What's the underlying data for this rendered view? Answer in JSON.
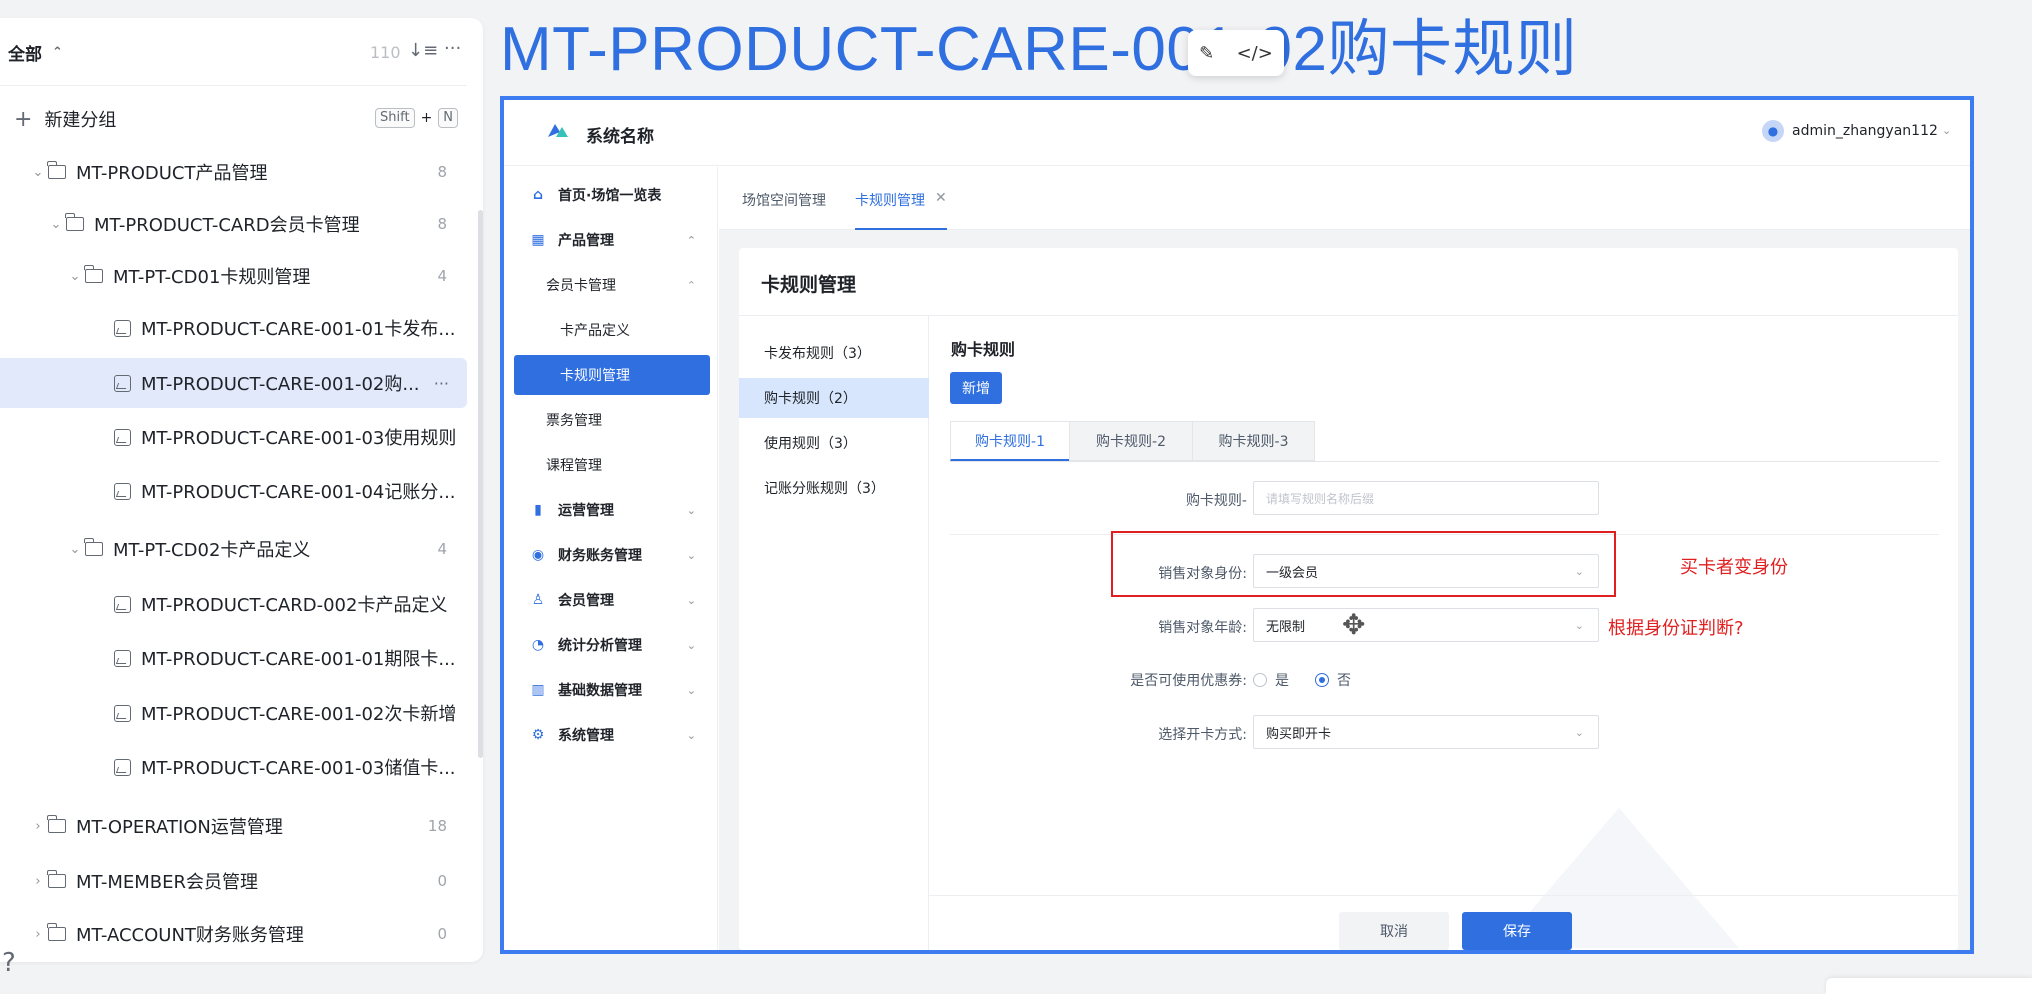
{
  "left_panel": {
    "header_title": "全部",
    "header_count": "110",
    "new_group_label": "新建分组",
    "shortcut": {
      "key1": "Shift",
      "plus": "+",
      "key2": "N"
    },
    "tree": [
      {
        "label": "MT-PRODUCT产品管理",
        "count": "8"
      },
      {
        "label": "MT-PRODUCT-CARD会员卡管理",
        "count": "8"
      },
      {
        "label": "MT-PT-CD01卡规则管理",
        "count": "4"
      },
      {
        "label": "MT-PRODUCT-CARE-001-01卡发布..."
      },
      {
        "label": "MT-PRODUCT-CARE-001-02购..."
      },
      {
        "label": "MT-PRODUCT-CARE-001-03使用规则"
      },
      {
        "label": "MT-PRODUCT-CARE-001-04记账分..."
      },
      {
        "label": "MT-PT-CD02卡产品定义",
        "count": "4"
      },
      {
        "label": "MT-PRODUCT-CARD-002卡产品定义"
      },
      {
        "label": "MT-PRODUCT-CARE-001-01期限卡..."
      },
      {
        "label": "MT-PRODUCT-CARE-001-02次卡新增"
      },
      {
        "label": "MT-PRODUCT-CARE-001-03储值卡..."
      },
      {
        "label": "MT-OPERATION运营管理",
        "count": "18"
      },
      {
        "label": "MT-MEMBER会员管理",
        "count": "0"
      },
      {
        "label": "MT-ACCOUNT财务账务管理",
        "count": "0"
      }
    ],
    "help": "?"
  },
  "page_title": "MT-PRODUCT-CARE-001-02购卡规则",
  "app": {
    "system_name": "系统名称",
    "user": "admin_zhangyan112",
    "menu": [
      {
        "label": "首页·场馆一览表",
        "icon": "home-icon"
      },
      {
        "label": "产品管理",
        "icon": "product-icon"
      },
      {
        "label": "会员卡管理"
      },
      {
        "label": "卡产品定义"
      },
      {
        "label": "卡规则管理"
      },
      {
        "label": "票务管理"
      },
      {
        "label": "课程管理"
      },
      {
        "label": "运营管理",
        "icon": "bar-chart-icon"
      },
      {
        "label": "财务账务管理",
        "icon": "finance-icon"
      },
      {
        "label": "会员管理",
        "icon": "member-icon"
      },
      {
        "label": "统计分析管理",
        "icon": "pie-icon"
      },
      {
        "label": "基础数据管理",
        "icon": "data-icon"
      },
      {
        "label": "系统管理",
        "icon": "settings-icon"
      }
    ],
    "tabs": [
      {
        "label": "场馆空间管理"
      },
      {
        "label": "卡规则管理",
        "close": "✕"
      }
    ],
    "card_title": "卡规则管理",
    "subnav": [
      "卡发布规则（3）",
      "购卡规则（2）",
      "使用规则（3）",
      "记账分账规则（3）"
    ],
    "section_title": "购卡规则",
    "add_button": "新增",
    "rule_tabs": [
      "购卡规则-1",
      "购卡规则-2",
      "购卡规则-3"
    ],
    "form": {
      "name_label": "购卡规则-",
      "name_placeholder": "请填写规则名称后缀",
      "identity_label": "销售对象身份:",
      "identity_value": "一级会员",
      "age_label": "销售对象年龄:",
      "age_value": "无限制",
      "coupon_label": "是否可使用优惠券:",
      "coupon_yes": "是",
      "coupon_no": "否",
      "open_label": "选择开卡方式:",
      "open_value": "购买即开卡"
    },
    "cancel": "取消",
    "save": "保存"
  },
  "annotations": {
    "note1": "买卡者变身份",
    "note2": "根据身份证判断?"
  }
}
